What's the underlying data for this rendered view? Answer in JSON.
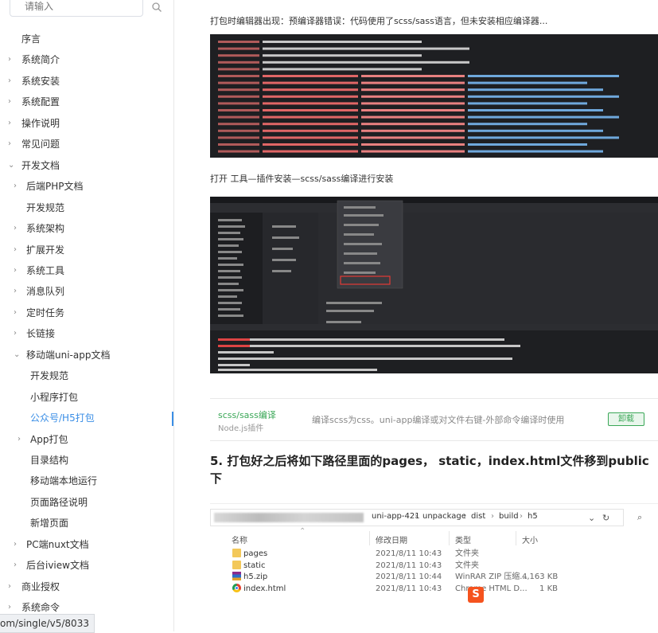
{
  "sidebar": {
    "search_placeholder": "请输入",
    "items": [
      {
        "label": "序言",
        "arrow": ""
      },
      {
        "label": "系统简介",
        "arrow": "›"
      },
      {
        "label": "系统安装",
        "arrow": "›"
      },
      {
        "label": "系统配置",
        "arrow": "›"
      },
      {
        "label": "操作说明",
        "arrow": "›"
      },
      {
        "label": "常见问题",
        "arrow": "›"
      },
      {
        "label": "开发文档",
        "arrow": "⌄"
      },
      {
        "label": "后端PHP文档",
        "arrow": "›"
      },
      {
        "label": "开发规范",
        "arrow": ""
      },
      {
        "label": "系统架构",
        "arrow": "›"
      },
      {
        "label": "扩展开发",
        "arrow": "›"
      },
      {
        "label": "系统工具",
        "arrow": "›"
      },
      {
        "label": "消息队列",
        "arrow": "›"
      },
      {
        "label": "定时任务",
        "arrow": "›"
      },
      {
        "label": "长链接",
        "arrow": "›"
      },
      {
        "label": "移动端uni-app文档",
        "arrow": "⌄"
      },
      {
        "label": "开发规范",
        "arrow": ""
      },
      {
        "label": "小程序打包",
        "arrow": ""
      },
      {
        "label": "公众号/H5打包",
        "arrow": ""
      },
      {
        "label": "App打包",
        "arrow": "›"
      },
      {
        "label": "目录结构",
        "arrow": ""
      },
      {
        "label": "移动端本地运行",
        "arrow": ""
      },
      {
        "label": "页面路径说明",
        "arrow": ""
      },
      {
        "label": "新增页面",
        "arrow": ""
      },
      {
        "label": "PC端nuxt文档",
        "arrow": "›"
      },
      {
        "label": "后台iview文档",
        "arrow": "›"
      },
      {
        "label": "商业授权",
        "arrow": "›"
      },
      {
        "label": "系统命令",
        "arrow": "›"
      }
    ]
  },
  "url_tooltip": "om/single/v5/8033",
  "content": {
    "para1": "打包时编辑器出现：预编译器错误：代码使用了scss/sass语言，但未安装相应编译器...",
    "para2": "打开 工具—插件安装—scss/sass编译进行安装",
    "plugin": {
      "name": "scss/sass编译",
      "sub": "Node.js插件",
      "desc": "编译scss为css。uni-app编译或对文件右键-外部命令编译时使用",
      "button": "卸载"
    },
    "heading5": "5. 打包好之后将如下路径里面的pages， static，index.html文件移到public下"
  },
  "explorer": {
    "breadcrumb": [
      "uni-app-421",
      "unpackage",
      "dist",
      "build",
      "h5"
    ],
    "columns": [
      "名称",
      "修改日期",
      "类型",
      "大小"
    ],
    "files": [
      {
        "name": "pages",
        "date": "2021/8/11 10:43",
        "type": "文件夹",
        "size": "",
        "icon": "folder-icon"
      },
      {
        "name": "static",
        "date": "2021/8/11 10:43",
        "type": "文件夹",
        "size": "",
        "icon": "folder-icon"
      },
      {
        "name": "h5.zip",
        "date": "2021/8/11 10:44",
        "type": "WinRAR ZIP 压缩...",
        "size": "4,163 KB",
        "icon": "zip-icon"
      },
      {
        "name": "index.html",
        "date": "2021/8/11 10:43",
        "type": "Chrome HTML D...",
        "size": "1 KB",
        "icon": "chrome-icon"
      }
    ]
  },
  "colors": {
    "accent": "#3a8ee6",
    "plugin_green": "#3aa757",
    "console_bg": "#1e1f22"
  }
}
